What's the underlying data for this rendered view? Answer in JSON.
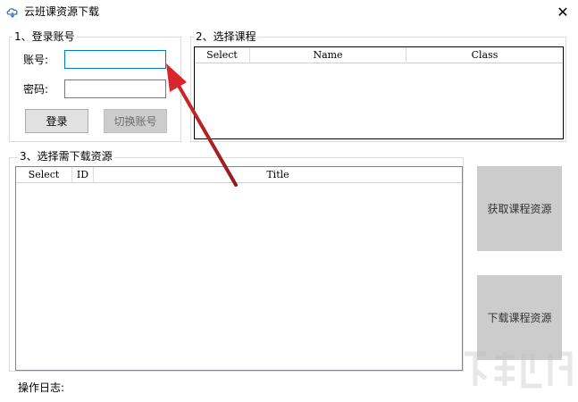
{
  "window": {
    "title": "云班课资源下载",
    "close_glyph": "✕"
  },
  "login": {
    "group_title": "1、登录账号",
    "account_label": "账号:",
    "account_value": "",
    "password_label": "密码:",
    "password_value": "",
    "login_button": "登录",
    "switch_button": "切换账号"
  },
  "courses": {
    "group_title": "2、选择课程",
    "columns": [
      "Select",
      "Name",
      "Class"
    ]
  },
  "resources": {
    "group_title": "3、选择需下载资源",
    "columns": [
      "Select",
      "ID",
      "Title"
    ]
  },
  "actions": {
    "fetch_button": "获取课程资源",
    "download_button": "下载课程资源"
  },
  "log": {
    "label": "操作日志:"
  },
  "colors": {
    "accent": "#0078d7",
    "arrow": "#d9252c"
  },
  "icons": {
    "app": "cloud-icon",
    "close": "close-icon",
    "annotation": "red-arrow-icon"
  }
}
